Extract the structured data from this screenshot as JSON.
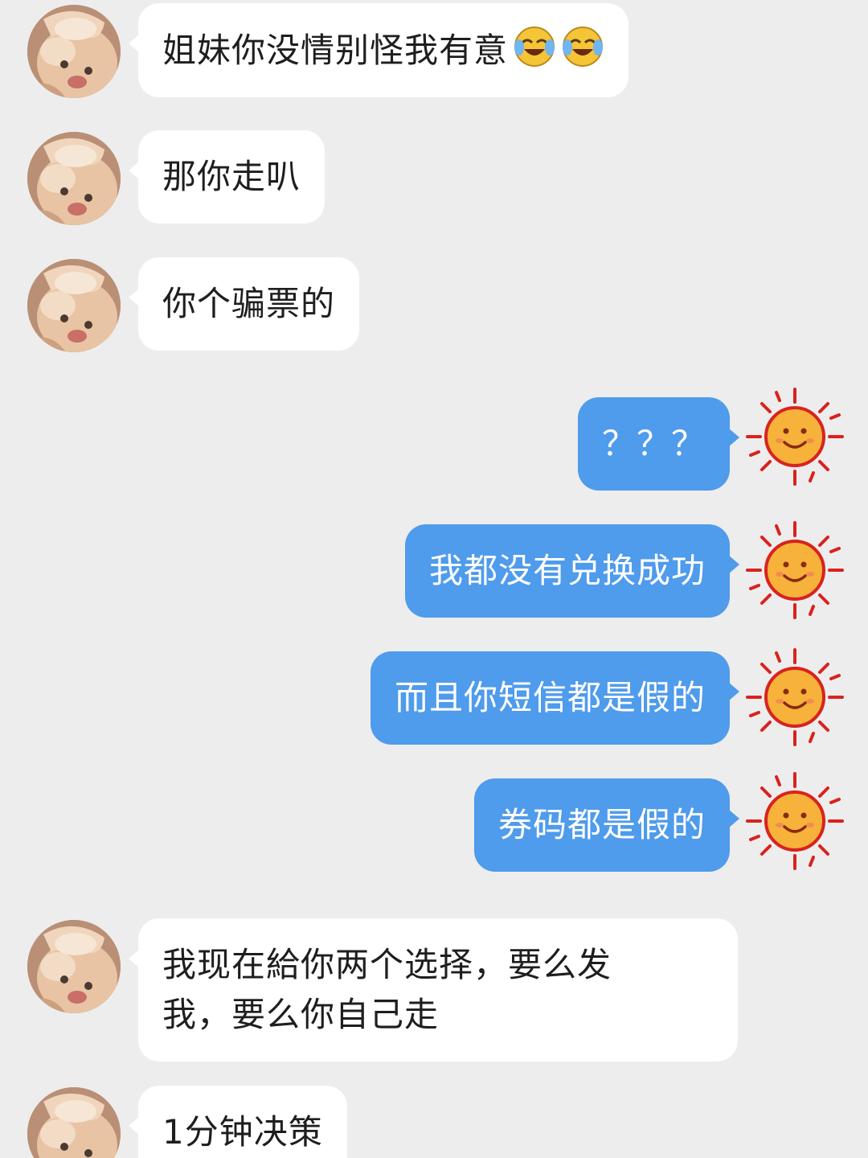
{
  "messages": [
    {
      "side": "in",
      "text": "姐妹你没情别怪我有意",
      "emojis": [
        "laughing-crying-emoji",
        "laughing-crying-emoji"
      ]
    },
    {
      "side": "in",
      "text": "那你走叭"
    },
    {
      "side": "in",
      "text": "你个骗票的"
    },
    {
      "side": "out",
      "text": "？？？"
    },
    {
      "side": "out",
      "text": "我都没有兑换成功"
    },
    {
      "side": "out",
      "text": "而且你短信都是假的"
    },
    {
      "side": "out",
      "text": "券码都是假的"
    },
    {
      "side": "in",
      "lines": [
        "我现在給你两个选择，要么发",
        "我，要么你自己走"
      ]
    },
    {
      "side": "in",
      "text": "1分钟决策"
    }
  ],
  "colors": {
    "background": "#ededed",
    "incoming_bubble": "#ffffff",
    "outgoing_bubble": "#4f9bec",
    "sun_ray": "#d8231f",
    "sun_face": "#f6b23a"
  },
  "icons": {
    "incoming_avatar": "cat-avatar-icon",
    "outgoing_avatar": "sun-avatar-icon"
  }
}
